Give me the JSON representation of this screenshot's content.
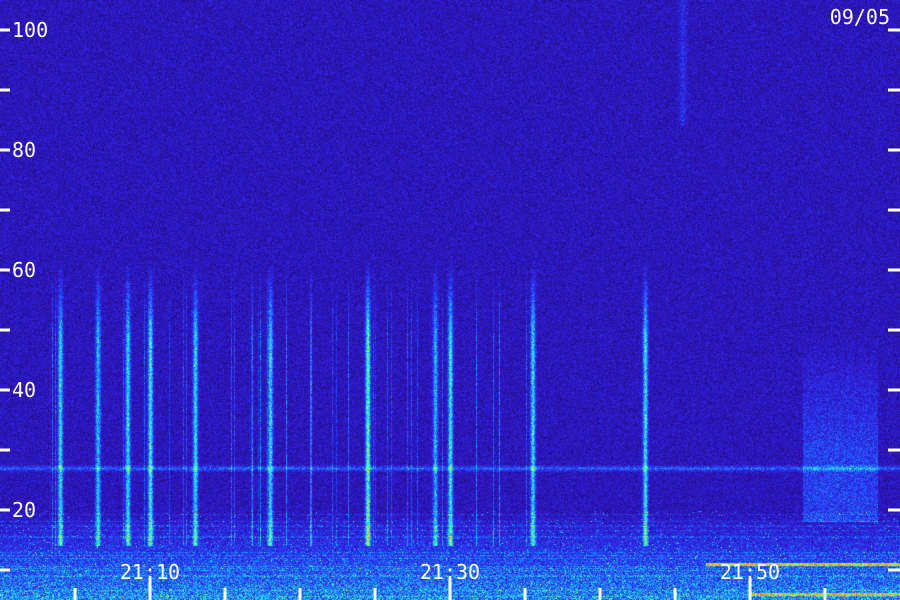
{
  "chart_data": {
    "type": "heatmap",
    "date_label": "09/05",
    "y_axis": {
      "tick_labels": [
        "100",
        "80",
        "60",
        "40",
        "20"
      ],
      "tick_values": [
        100,
        80,
        60,
        40,
        20
      ],
      "minor_tick_values": [
        90,
        70,
        50,
        30,
        10
      ],
      "range": [
        0,
        100
      ]
    },
    "x_axis": {
      "tick_labels": [
        "21:10",
        "21:30",
        "21:50"
      ],
      "tick_minutes": [
        10,
        30,
        50
      ],
      "minor_tick_count": 12,
      "range_minutes": [
        0,
        60
      ]
    },
    "grid": false,
    "colormap": [
      "#1a0a4a",
      "#2a10a0",
      "#3020e0",
      "#2060ff",
      "#20c0ff",
      "#40ffc0",
      "#c0ff40",
      "#ff8000"
    ],
    "features": {
      "horizontal_band_level": 27,
      "low_band_top_level": 20,
      "vertical_bursts_minutes": [
        4,
        6.5,
        8.5,
        10,
        13,
        18,
        24.5,
        29,
        30,
        35.5,
        43
      ],
      "diffuse_region_minutes": [
        53.5,
        58.5
      ],
      "late_vertical_streak_minutes": 45.5,
      "hot_line_levels": [
        11,
        6
      ]
    }
  }
}
